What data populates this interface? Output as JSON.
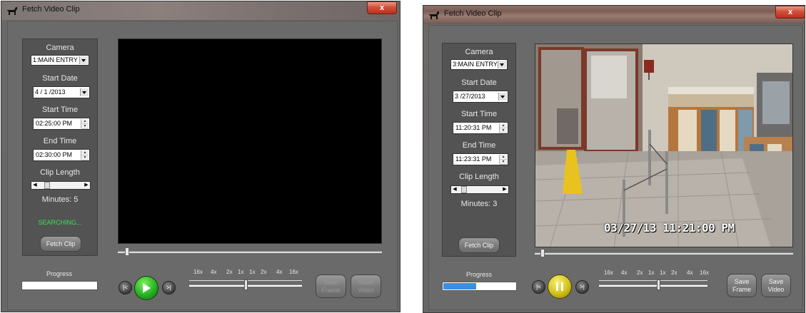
{
  "windows": [
    {
      "title": "Fetch Video Clip",
      "close_label": "x",
      "camera_label": "Camera",
      "camera_value": "1:MAIN ENTRY",
      "start_date_label": "Start Date",
      "start_date_value": "4 / 1 /2013",
      "start_time_label": "Start Time",
      "start_time_value": "02:25:00 PM",
      "end_time_label": "End Time",
      "end_time_value": "02:30:00 PM",
      "clip_length_label": "Clip Length",
      "minutes_text": "Minutes: 5",
      "status_text": "SEARCHING...",
      "status_color": "#3de05a",
      "fetch_label": "Fetch Clip",
      "progress_label": "Progress",
      "progress_fraction": 0.0,
      "play_state": "play",
      "speed_labels": [
        "16x",
        "4x",
        "2x",
        "1x",
        "1x",
        "2x",
        "4x",
        "16x"
      ],
      "save_frame_label": "Save Frame",
      "save_video_label": "Save Video",
      "prev_label": "|<",
      "next_label": ">|",
      "video_blank": true
    },
    {
      "title": "Fetch Video Clip",
      "close_label": "x",
      "camera_label": "Camera",
      "camera_value": "3:MAIN ENTRY",
      "start_date_label": "Start Date",
      "start_date_value": "3 /27/2013",
      "start_time_label": "Start Time",
      "start_time_value": "11:20:31 PM",
      "end_time_label": "End Time",
      "end_time_value": "11:23:31 PM",
      "clip_length_label": "Clip Length",
      "minutes_text": "Minutes: 3",
      "status_text": "",
      "fetch_label": "Fetch Clip",
      "progress_label": "Progress",
      "progress_fraction": 0.45,
      "play_state": "pause",
      "speed_labels": [
        "16x",
        "4x",
        "2x",
        "1x",
        "1x",
        "2x",
        "4x",
        "16x"
      ],
      "save_frame_label": "Save Frame",
      "save_video_label": "Save Video",
      "prev_label": "|<",
      "next_label": ">|",
      "video_timestamp": "03/27/13 11:21:00 PM",
      "video_blank": false
    }
  ]
}
